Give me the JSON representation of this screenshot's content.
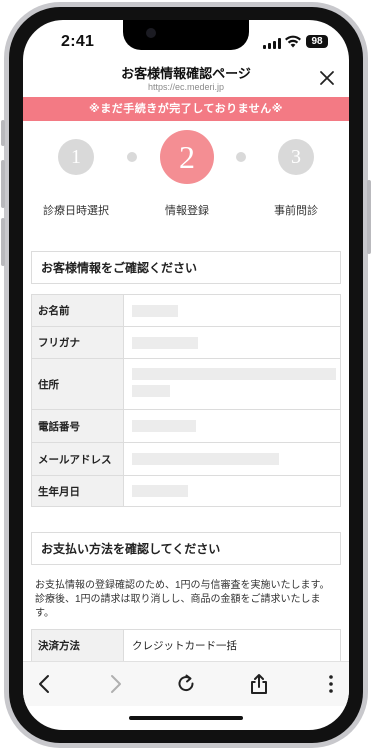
{
  "status": {
    "time": "2:41",
    "battery": "98"
  },
  "header": {
    "title": "お客様情報確認ページ",
    "url": "https://ec.mederi.jp"
  },
  "notice": "※まだ手続きが完了しておりません※",
  "steps": [
    {
      "number": "1",
      "label": "診療日時選択",
      "state": "done"
    },
    {
      "number": "2",
      "label": "情報登録",
      "state": "current"
    },
    {
      "number": "3",
      "label": "事前問診",
      "state": "pending"
    }
  ],
  "customer_section": {
    "title": "お客様情報をご確認ください",
    "rows": [
      {
        "label": "お名前"
      },
      {
        "label": "フリガナ"
      },
      {
        "label": "住所"
      },
      {
        "label": "電話番号"
      },
      {
        "label": "メールアドレス"
      },
      {
        "label": "生年月日"
      }
    ]
  },
  "payment_section": {
    "title": "お支払い方法を確認してください",
    "description": "お支払情報の登録確認のため、1円の与信審査を実施いたします。診療後、1円の請求は取り消しし、商品の金額をご請求いたします。",
    "rows": [
      {
        "label": "決済方法",
        "value": "クレジットカード一括"
      }
    ]
  },
  "colors": {
    "accent": "#f37a84",
    "step_active": "#f48e93",
    "step_inactive": "#d9d9d9"
  },
  "toolbar": {
    "icons": [
      "back-icon",
      "forward-icon",
      "reload-icon",
      "share-icon",
      "more-icon"
    ]
  }
}
